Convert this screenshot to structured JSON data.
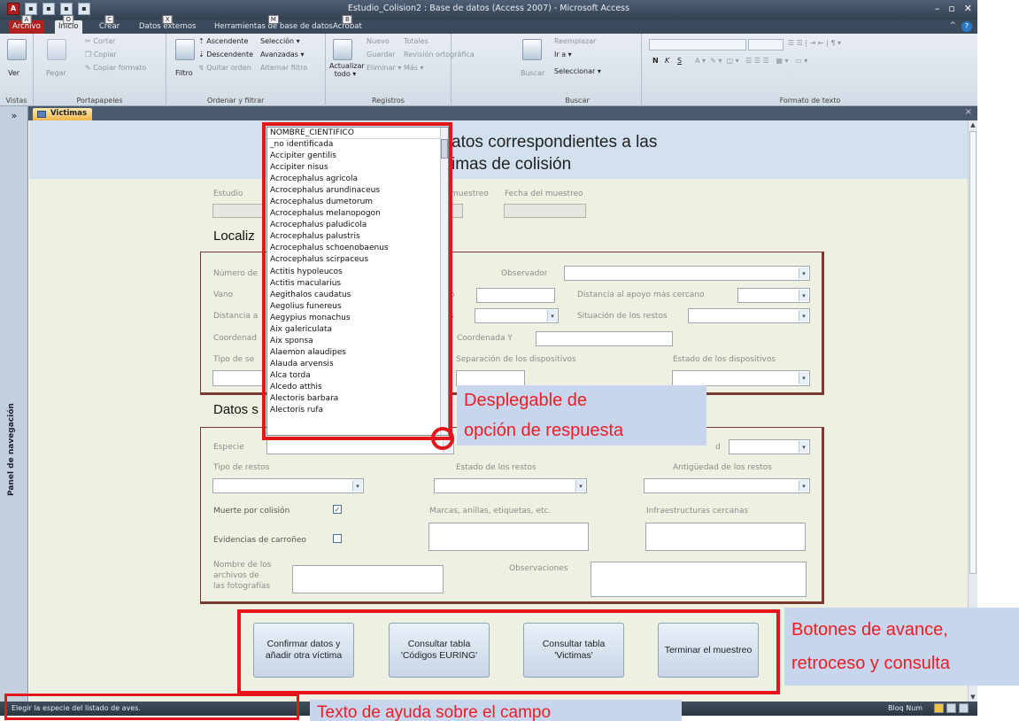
{
  "window": {
    "title": "Estudio_Colision2 : Base de datos (Access 2007) - Microsoft Access",
    "min": "–",
    "max": "▫",
    "close": "✕"
  },
  "ribbon_tabs": [
    {
      "label": "Archivo",
      "keytip": "A"
    },
    {
      "label": "Inicio",
      "keytip": "O"
    },
    {
      "label": "Crear",
      "keytip": "C"
    },
    {
      "label": "Datos externos",
      "keytip": "X"
    },
    {
      "label": "Herramientas de base de datos",
      "keytip": "M"
    },
    {
      "label": "Acrobat",
      "keytip": "B"
    }
  ],
  "ribbon": {
    "vistas": {
      "ver": "Ver",
      "group": "Vistas"
    },
    "portapapeles": {
      "pegar": "Pegar",
      "cortar": "Cortar",
      "copiar": "Copiar",
      "copiar_formato": "Copiar formato",
      "group": "Portapapeles"
    },
    "ordenar": {
      "filtro": "Filtro",
      "ascendente": "Ascendente",
      "descendente": "Descendente",
      "quitar_orden": "Quitar orden",
      "seleccion": "Selección ▾",
      "avanzadas": "Avanzadas ▾",
      "alternar_filtro": "Alternar filtro",
      "group": "Ordenar y filtrar"
    },
    "registros": {
      "actualizar": "Actualizar todo ▾",
      "nuevo": "Nuevo",
      "guardar": "Guardar",
      "eliminar": "Eliminar ▾",
      "totales": "Totales",
      "ortografia": "Revisión ortográfica",
      "mas": "Más ▾",
      "group": "Registros"
    },
    "buscar": {
      "buscar": "Buscar",
      "reemplazar": "Reemplazar",
      "ir_a": "Ir a ▾",
      "seleccionar": "Seleccionar ▾",
      "group": "Buscar"
    },
    "formato": {
      "bold": "N",
      "italic": "K",
      "underline": "S",
      "group": "Formato de texto"
    }
  },
  "nav_pane": {
    "label": "Panel de navegación",
    "toggle": "»"
  },
  "doc_tab": {
    "label": "Victimas",
    "close": "×"
  },
  "form": {
    "title_line1": "atos correspondientes a las",
    "title_line2": "imas de colisión",
    "header_fields": {
      "estudio": "Estudio",
      "muestreo": "muestreo",
      "fecha": "Fecha del muestreo"
    },
    "section1": "Localiz",
    "loc": {
      "numero": "Número de",
      "observador": "Observador",
      "vano": "Vano",
      "distancia_apoyo": "Distancia al apoyo más cercano",
      "distancia": "Distancia a",
      "situacion": "Situación de los restos",
      "coord_x": "Coordenad",
      "coord_y": "Coordenada Y",
      "tipo_sen": "Tipo de se",
      "separacion": "Separación de los dispositivos",
      "estado_disp": "Estado de los dispositivos",
      "frag1": "o",
      "frag2": "s"
    },
    "section2": "Datos s",
    "datos": {
      "especie": "Especie",
      "edad_frag": "d",
      "tipo_restos": "Tipo de restos",
      "estado_restos": "Estado de los restos",
      "antiguedad": "Antigüedad de los restos",
      "muerte": "Muerte por colisión",
      "muerte_checked": "✓",
      "marcas": "Marcas, anillas, etiquetas, etc.",
      "infra": "Infraestructuras cercanas",
      "carroneo": "Evidencias de carroñeo",
      "nombre_arch": "Nombre de los archivos de las fotografías",
      "observaciones": "Observaciones"
    },
    "buttons": [
      "Confirmar datos y añadir otra víctima",
      "Consultar tabla 'Códigos EURING'",
      "Consultar tabla 'Victimas'",
      "Terminar el muestreo"
    ]
  },
  "species_list": {
    "header": "NOMBRE_CIENTIFICO",
    "items": [
      "_no identificada",
      "Accipiter gentilis",
      "Accipiter nisus",
      "Acrocephalus agricola",
      "Acrocephalus arundinaceus",
      "Acrocephalus dumetorum",
      "Acrocephalus melanopogon",
      "Acrocephalus paludicola",
      "Acrocephalus palustris",
      "Acrocephalus schoenobaenus",
      "Acrocephalus scirpaceus",
      "Actitis hypoleucos",
      "Actitis macularius",
      "Aegithalos caudatus",
      "Aegolius funereus",
      "Aegypius monachus",
      "Aix galericulata",
      "Aix sponsa",
      "Alaemon alaudipes",
      "Alauda arvensis",
      "Alca torda",
      "Alcedo atthis",
      "Alectoris barbara",
      "Alectoris rufa"
    ]
  },
  "annotations": {
    "dropdown_line1": "Desplegable de",
    "dropdown_line2": "opción de respuesta",
    "buttons_line1": "Botones de avance,",
    "buttons_line2": "retroceso y consulta",
    "help_text": "Texto de ayuda sobre el campo"
  },
  "status_bar": {
    "message": "Elegir la especie del listado de aves.",
    "bloq": "Bloq Num"
  }
}
